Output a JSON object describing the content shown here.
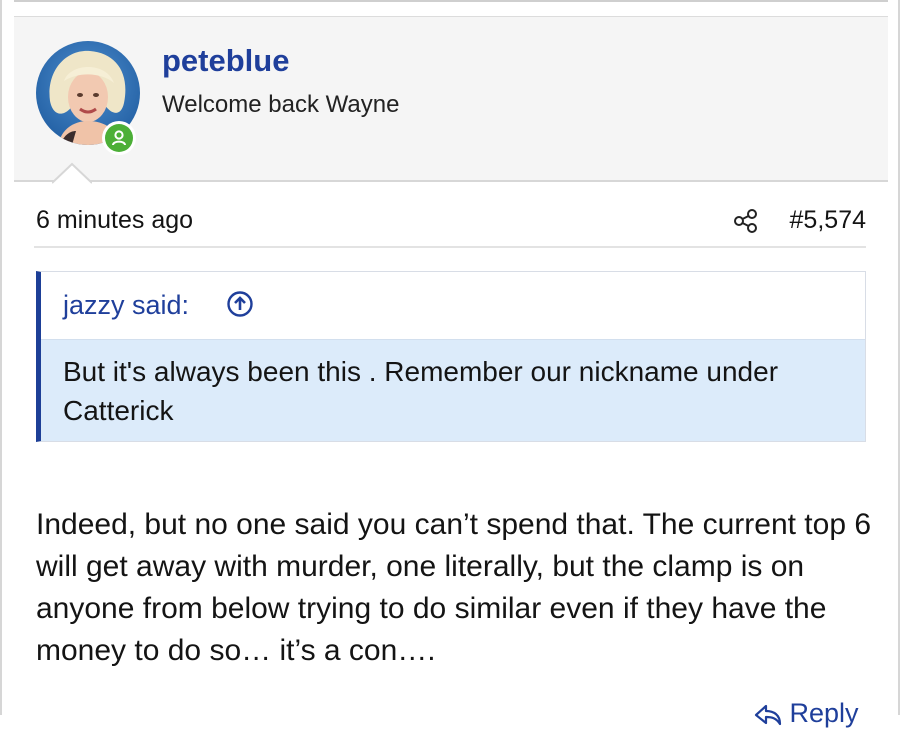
{
  "post": {
    "author": {
      "username": "peteblue",
      "title": "Welcome back Wayne",
      "status": "online"
    },
    "time_ago": "6 minutes ago",
    "post_number": "#5,574",
    "quote": {
      "attribution": "jazzy said:",
      "text": "But it's always been this . Remember our nickname under Catterick"
    },
    "message": "Indeed, but no one said you can’t spend that. The current top 6 will get away with murder, one literally, but the clamp is on anyone from below trying to do similar even if they have the money to do so… it’s a con….",
    "reply_label": "Reply"
  },
  "icons": {
    "online": "user-online-icon",
    "share": "share-icon",
    "goto_quote": "arrow-up-circle-icon",
    "reply": "reply-icon"
  },
  "colors": {
    "accent": "#1f3f9b",
    "quote_background": "#dcebfa",
    "online": "#4caf37"
  }
}
